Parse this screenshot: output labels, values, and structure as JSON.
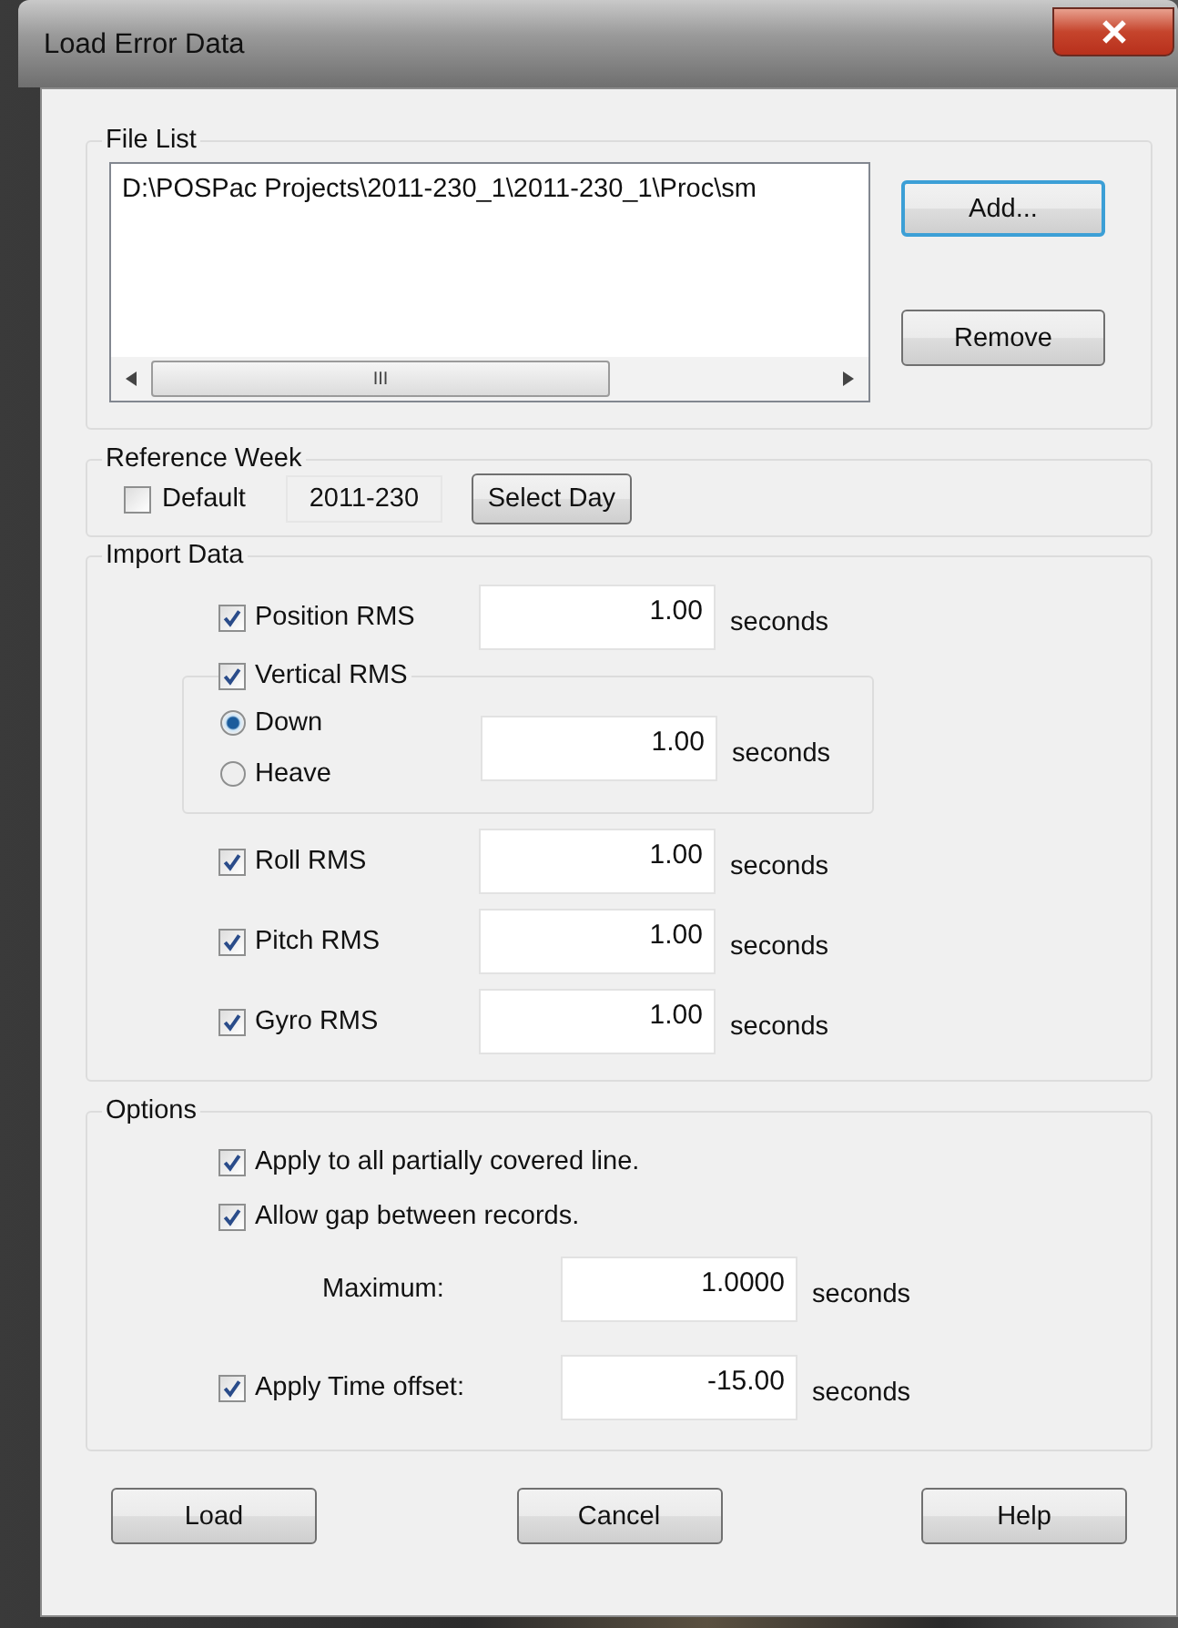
{
  "window": {
    "title": "Load Error Data"
  },
  "file_list": {
    "title": "File List",
    "items": [
      "D:\\POSPac Projects\\2011-230_1\\2011-230_1\\Proc\\sm"
    ],
    "scrollbar_thumb": "III",
    "buttons": [
      {
        "label": "Add...",
        "focused": true
      },
      {
        "label": "Remove",
        "focused": false
      }
    ]
  },
  "reference_week": {
    "title": "Reference Week",
    "default": {
      "label": "Default",
      "checked": false
    },
    "value": "2011-230",
    "button": "Select Day"
  },
  "import_data": {
    "title": "Import Data",
    "rows": [
      {
        "kind": "check",
        "label": "Position RMS",
        "checked": true,
        "value": "1.00",
        "unit": "seconds"
      },
      {
        "kind": "vertical",
        "label": "Vertical RMS",
        "checked": true,
        "options": [
          {
            "label": "Down",
            "selected": true
          },
          {
            "label": "Heave",
            "selected": false
          }
        ],
        "value": "1.00",
        "unit": "seconds"
      },
      {
        "kind": "check",
        "label": "Roll RMS",
        "checked": true,
        "value": "1.00",
        "unit": "seconds"
      },
      {
        "kind": "check",
        "label": "Pitch RMS",
        "checked": true,
        "value": "1.00",
        "unit": "seconds"
      },
      {
        "kind": "check",
        "label": "Gyro RMS",
        "checked": true,
        "value": "1.00",
        "unit": "seconds"
      }
    ]
  },
  "options": {
    "title": "Options",
    "items": [
      {
        "kind": "check",
        "label": "Apply to all partially covered line.",
        "checked": true
      },
      {
        "kind": "check",
        "label": "Allow gap between records.",
        "checked": true
      },
      {
        "kind": "field",
        "label": "Maximum:",
        "value": "1.0000",
        "unit": "seconds"
      },
      {
        "kind": "check_field",
        "label": "Apply Time offset:",
        "checked": true,
        "value": "-15.00",
        "unit": "seconds"
      }
    ]
  },
  "buttons": [
    "Load",
    "Cancel",
    "Help"
  ]
}
